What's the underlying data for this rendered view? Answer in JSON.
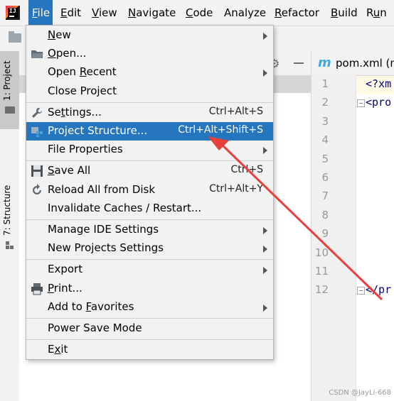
{
  "menubar": {
    "items": [
      {
        "name": "file",
        "label": "File",
        "mn": "F",
        "active": true
      },
      {
        "name": "edit",
        "label": "Edit",
        "mn": "E"
      },
      {
        "name": "view",
        "label": "View",
        "mn": "V"
      },
      {
        "name": "navigate",
        "label": "Navigate",
        "mn": "N"
      },
      {
        "name": "code",
        "label": "Code",
        "mn": "C"
      },
      {
        "name": "analyze",
        "label": "Analyze"
      },
      {
        "name": "refactor",
        "label": "Refactor",
        "mn": "R"
      },
      {
        "name": "build",
        "label": "Build",
        "mn": "B"
      },
      {
        "name": "run",
        "label": "Run",
        "mn": "u"
      }
    ]
  },
  "app_icon_text": "IJ",
  "tool_strip": {
    "project_label": "1: Project",
    "structure_label": "7: Structure"
  },
  "editor": {
    "tab_icon": "m",
    "tab_title": "pom.xml (n",
    "line_numbers": [
      "1",
      "2",
      "3",
      "4",
      "5",
      "6",
      "7",
      "8",
      "9",
      "10",
      "11",
      "12"
    ],
    "code_lines": [
      {
        "line": 1,
        "text": "<?xm"
      },
      {
        "line": 2,
        "text": "<pro"
      },
      {
        "line": 12,
        "text": "</pr"
      }
    ]
  },
  "file_menu": {
    "items": [
      {
        "label": "New",
        "mn": "N",
        "submenu": true,
        "icon": ""
      },
      {
        "label": "Open...",
        "mn": "O",
        "icon": "open-folder-icon"
      },
      {
        "label": "Open Recent",
        "mn": "R",
        "submenu": true,
        "icon": ""
      },
      {
        "label": "Close Project",
        "icon": ""
      },
      {
        "sep": true
      },
      {
        "label": "Settings...",
        "mn": "t",
        "shortcut": "Ctrl+Alt+S",
        "icon": "wrench-icon"
      },
      {
        "label": "Project Structure...",
        "shortcut": "Ctrl+Alt+Shift+S",
        "icon": "project-structure-icon",
        "selected": true
      },
      {
        "label": "File Properties",
        "submenu": true,
        "icon": ""
      },
      {
        "sep": true
      },
      {
        "label": "Save All",
        "mn": "S",
        "shortcut": "Ctrl+S",
        "icon": "save-icon"
      },
      {
        "label": "Reload All from Disk",
        "shortcut": "Ctrl+Alt+Y",
        "icon": "reload-icon"
      },
      {
        "label": "Invalidate Caches / Restart...",
        "icon": ""
      },
      {
        "sep": true
      },
      {
        "label": "Manage IDE Settings",
        "submenu": true,
        "icon": ""
      },
      {
        "label": "New Projects Settings",
        "submenu": true,
        "icon": ""
      },
      {
        "sep": true
      },
      {
        "label": "Export",
        "submenu": true,
        "icon": ""
      },
      {
        "label": "Print...",
        "mn": "P",
        "icon": "printer-icon"
      },
      {
        "label": "Add to Favorites",
        "mn": "F",
        "submenu": true,
        "icon": ""
      },
      {
        "sep": true
      },
      {
        "label": "Power Save Mode",
        "icon": ""
      },
      {
        "sep": true
      },
      {
        "label": "Exit",
        "mn": "x",
        "icon": ""
      }
    ]
  },
  "colors": {
    "accent": "#2675bf",
    "annotation": "#e8413c"
  },
  "watermark": "CSDN @JayLi-668"
}
